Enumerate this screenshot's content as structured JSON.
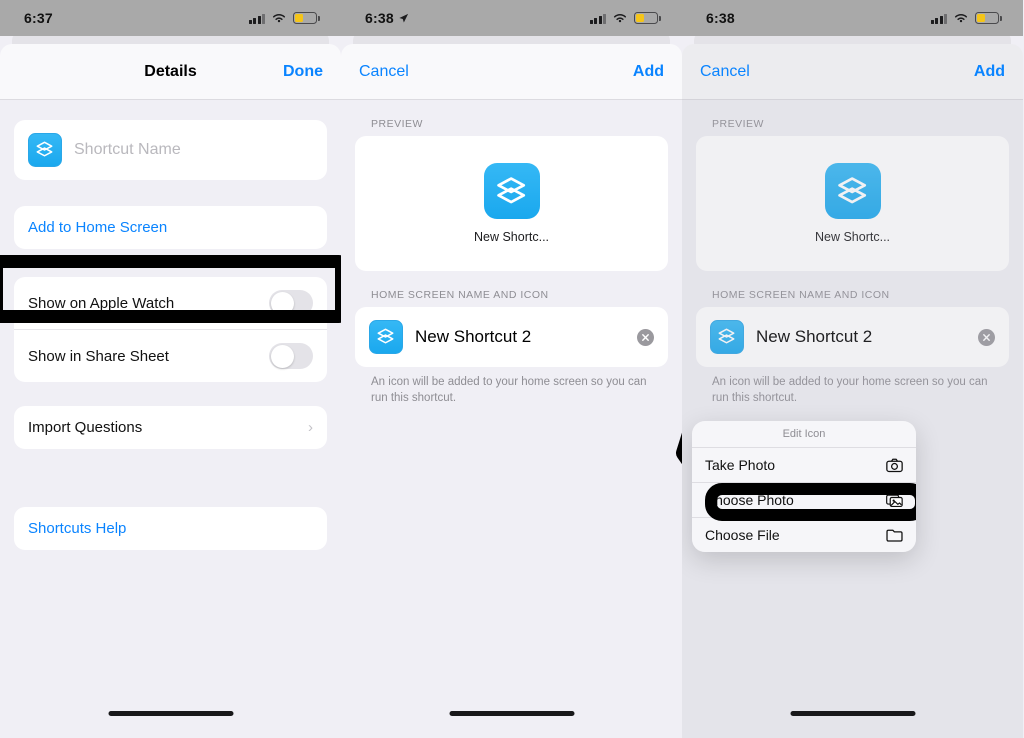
{
  "panels": [
    {
      "status": {
        "time": "6:37",
        "location_arrow": false,
        "battery_level": "38%",
        "battery_color": "#f5c518"
      },
      "nav": {
        "left": "",
        "title": "Details",
        "right": "Done"
      },
      "name_field": {
        "placeholder": "Shortcut Name",
        "icon": "shortcuts-app-icon"
      },
      "actions": [
        {
          "label": "Add to Home Screen",
          "style": "link",
          "highlighted": true
        }
      ],
      "toggles": [
        {
          "label": "Show on Apple Watch",
          "on": false
        },
        {
          "label": "Show in Share Sheet",
          "on": false
        }
      ],
      "disclosure": [
        {
          "label": "Import Questions",
          "chevron": "›"
        }
      ],
      "help": [
        {
          "label": "Shortcuts Help",
          "style": "link"
        }
      ]
    },
    {
      "status": {
        "time": "6:38",
        "location_arrow": true,
        "battery_level": "38%",
        "battery_color": "#f5c518"
      },
      "nav": {
        "left": "Cancel",
        "title": "",
        "right": "Add"
      },
      "preview": {
        "section_label": "PREVIEW",
        "icon_label": "New Shortc...",
        "icon": "shortcuts-app-icon"
      },
      "home_screen": {
        "section_label": "HOME SCREEN NAME AND ICON",
        "name_value": "New Shortcut 2",
        "clear_button": "clear-icon",
        "footnote": "An icon will be added to your home screen so you can run this shortcut."
      },
      "cursor": {
        "type": "arrow-pointer",
        "color": "#000000"
      }
    },
    {
      "status": {
        "time": "6:38",
        "location_arrow": false,
        "battery_level": "38%",
        "battery_color": "#f5c518"
      },
      "nav": {
        "left": "Cancel",
        "title": "",
        "right": "Add"
      },
      "preview": {
        "section_label": "PREVIEW",
        "icon_label": "New Shortc...",
        "icon": "shortcuts-app-icon"
      },
      "home_screen": {
        "section_label": "HOME SCREEN NAME AND ICON",
        "name_value": "New Shortcut 2",
        "clear_button": "clear-icon",
        "footnote": "An icon will be added to your home screen so you can run this shortcut."
      },
      "context_menu": {
        "title": "Edit Icon",
        "items": [
          {
            "label": "Take Photo",
            "icon": "camera-icon",
            "highlighted": false
          },
          {
            "label": "Choose Photo",
            "icon": "photos-icon",
            "highlighted": true
          },
          {
            "label": "Choose File",
            "icon": "folder-icon",
            "highlighted": false
          }
        ]
      }
    }
  ],
  "colors": {
    "accent_blue": "#0a84ff",
    "icon_blue": "#1aa8ee",
    "background": "#f0eff5",
    "card": "#ffffff",
    "highlight": "#000000",
    "status_bar": "#a9a9a9"
  }
}
